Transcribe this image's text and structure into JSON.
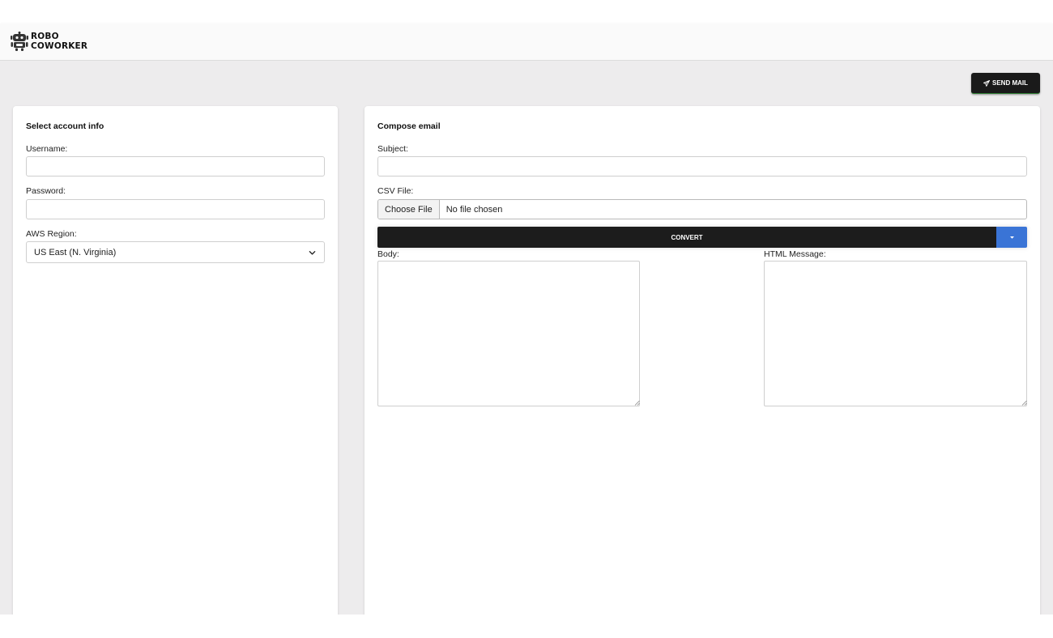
{
  "app": {
    "logo_line1": "ROBO",
    "logo_line2": "COWORKER",
    "logo_icon": "robot-icon"
  },
  "toolbar": {
    "send_label": "SEND MAIL",
    "send_icon": "paper-plane-icon"
  },
  "account": {
    "title": "Select account info",
    "username_label": "Username:",
    "username_value": "",
    "password_label": "Password:",
    "password_value": "",
    "region_label": "AWS Region:",
    "region_value": "US East (N. Virginia)",
    "region_icon": "chevron-down-icon"
  },
  "compose": {
    "title": "Compose email",
    "subject_label": "Subject:",
    "subject_value": "",
    "csv_label": "CSV File:",
    "choose_file_label": "Choose File",
    "file_status": "No file chosen",
    "convert_label": "CONVERT",
    "convert_dropdown_icon": "caret-down-icon",
    "body_label": "Body:",
    "body_value": "",
    "html_label": "HTML Message:",
    "html_value": ""
  },
  "colors": {
    "page_bg": "#edeced",
    "navbar_bg": "#fafafa",
    "dark_button": "#1c1c1c",
    "accent_blue": "#3a74d6"
  }
}
